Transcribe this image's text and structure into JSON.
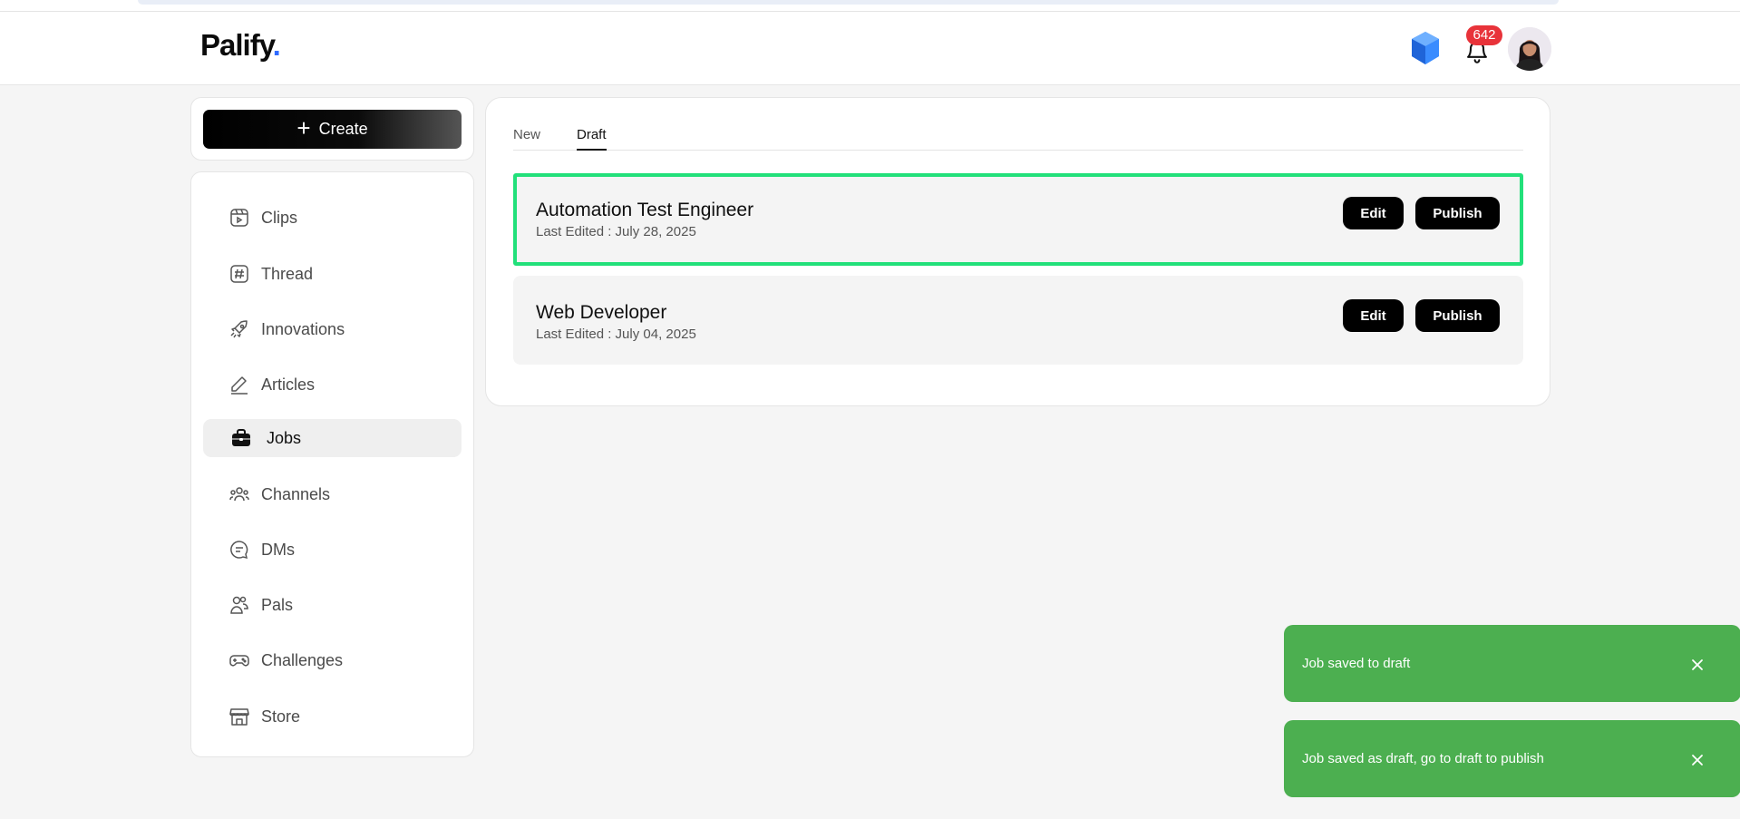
{
  "app": {
    "logo_text": "Palify",
    "logo_dot": ".",
    "brand_color": "#2f6bff"
  },
  "header": {
    "notification_count": "642",
    "icons": [
      "gem-icon",
      "bell-icon",
      "avatar"
    ]
  },
  "create": {
    "label": "Create"
  },
  "sidebar": {
    "items": [
      {
        "label": "Clips",
        "icon": "clips-icon"
      },
      {
        "label": "Thread",
        "icon": "hashtag-icon"
      },
      {
        "label": "Innovations",
        "icon": "rocket-icon"
      },
      {
        "label": "Articles",
        "icon": "pen-icon"
      },
      {
        "label": "Jobs",
        "icon": "briefcase-icon",
        "active": true
      },
      {
        "label": "Channels",
        "icon": "channels-icon"
      },
      {
        "label": "DMs",
        "icon": "chat-icon"
      },
      {
        "label": "Pals",
        "icon": "pals-icon"
      },
      {
        "label": "Challenges",
        "icon": "gamepad-icon"
      },
      {
        "label": "Store",
        "icon": "store-icon"
      }
    ]
  },
  "main": {
    "tabs": [
      {
        "label": "New",
        "active": false
      },
      {
        "label": "Draft",
        "active": true
      }
    ],
    "jobs": [
      {
        "title": "Automation Test Engineer",
        "meta": "Last Edited : July 28, 2025",
        "edit_label": "Edit",
        "publish_label": "Publish",
        "highlighted": true
      },
      {
        "title": "Web Developer",
        "meta": "Last Edited : July 04, 2025",
        "edit_label": "Edit",
        "publish_label": "Publish",
        "highlighted": false
      }
    ]
  },
  "toasts": [
    {
      "message": "Job saved to draft"
    },
    {
      "message": "Job saved as draft, go to draft to publish"
    }
  ],
  "colors": {
    "highlight_border": "#22e07a",
    "toast_bg": "#4caf50",
    "badge_bg": "#e8333a"
  }
}
